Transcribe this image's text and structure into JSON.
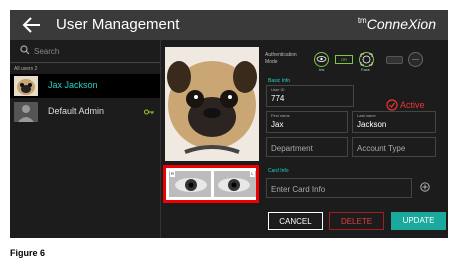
{
  "header": {
    "title": "User Management",
    "brand_prefix": "tm",
    "brand_name": "ConneXion"
  },
  "search": {
    "placeholder": "Search"
  },
  "user_list": {
    "section_label": "All users",
    "count": "2",
    "users": [
      {
        "name": "Jax Jackson",
        "selected": true
      },
      {
        "name": "Default Admin",
        "selected": false,
        "icon": "key-icon"
      }
    ]
  },
  "auth_mode": {
    "label_line1": "Authentication",
    "label_line2": "Mode",
    "options": [
      {
        "label": "Iris",
        "icon": "eye-icon",
        "active": true
      },
      {
        "label": "OR",
        "icon": "or-connector",
        "active": true
      },
      {
        "label": "Face",
        "icon": "face-icon",
        "active": true
      },
      {
        "label": "",
        "icon": "card-icon",
        "active": false
      },
      {
        "label": "",
        "icon": "pin-icon",
        "active": false
      }
    ]
  },
  "basic_info": {
    "section_label": "Basic Info",
    "user_id_label": "User ID",
    "user_id": "774",
    "status": "Active",
    "first_name_label": "First name",
    "first_name": "Jax",
    "last_name_label": "Last name",
    "last_name": "Jackson",
    "department_placeholder": "Department",
    "account_type_placeholder": "Account Type"
  },
  "card_info": {
    "section_label": "Card Info",
    "placeholder": "Enter Card Info"
  },
  "iris_captures": [
    {
      "tag": "R"
    },
    {
      "tag": "L"
    }
  ],
  "actions": {
    "cancel": "CANCEL",
    "delete": "DELETE",
    "update": "UPDATE"
  },
  "caption": "Figure 6",
  "colors": {
    "accent": "#22d3c5",
    "update_button": "#1aa99c",
    "active_status": "#e33333",
    "iris_highlight": "#ee0000"
  }
}
